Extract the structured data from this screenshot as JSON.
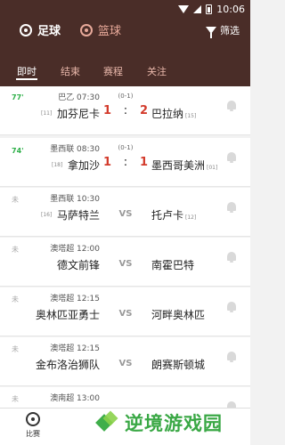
{
  "status": {
    "time": "10:06"
  },
  "sports": {
    "football": "足球",
    "basketball": "篮球"
  },
  "filter_label": "筛选",
  "tabs": [
    "即时",
    "结束",
    "赛程",
    "关注"
  ],
  "matches": [
    {
      "minute": "77'",
      "league": "巴乙 07:30",
      "halftime": "(0-1)",
      "home_rank": "[11]",
      "home": "加芬尼卡",
      "score_home": "1",
      "score_sep": ":",
      "score_away": "2",
      "away": "巴拉纳",
      "away_rank": "[15]"
    },
    {
      "minute": "74'",
      "league": "墨西联 08:30",
      "halftime": "(0-1)",
      "home_rank": "[18]",
      "home": "拿加沙",
      "score_home": "1",
      "score_sep": ":",
      "score_away": "1",
      "away": "墨西哥美洲",
      "away_rank": "[01]"
    },
    {
      "minute": "未",
      "league": "墨西联 10:30",
      "halftime": "",
      "home_rank": "[16]",
      "home": "马萨特兰",
      "vs": "VS",
      "away": "托卢卡",
      "away_rank": "[12]"
    },
    {
      "minute": "未",
      "league": "澳塔超 12:00",
      "halftime": "",
      "home_rank": "",
      "home": "德文前锋",
      "vs": "VS",
      "away": "南霍巴特",
      "away_rank": ""
    },
    {
      "minute": "未",
      "league": "澳塔超 12:15",
      "halftime": "",
      "home_rank": "",
      "home": "奥林匹亚勇士",
      "vs": "VS",
      "away": "河畔奥林匹",
      "away_rank": ""
    },
    {
      "minute": "未",
      "league": "澳塔超 12:15",
      "halftime": "",
      "home_rank": "",
      "home": "金布洛治狮队",
      "vs": "VS",
      "away": "朗赛斯顿城",
      "away_rank": ""
    },
    {
      "minute": "未",
      "league": "澳南超 13:00",
      "halftime": "",
      "home_rank": "",
      "home": "",
      "vs": "",
      "away": "",
      "away_rank": ""
    }
  ],
  "bottom_nav": {
    "label": "比赛"
  },
  "watermark": "逆境游戏园",
  "colors": {
    "header": "#4a2d28",
    "live_minute": "#2fb04a",
    "score": "#d33b2c",
    "watermark": "#3aa845"
  }
}
